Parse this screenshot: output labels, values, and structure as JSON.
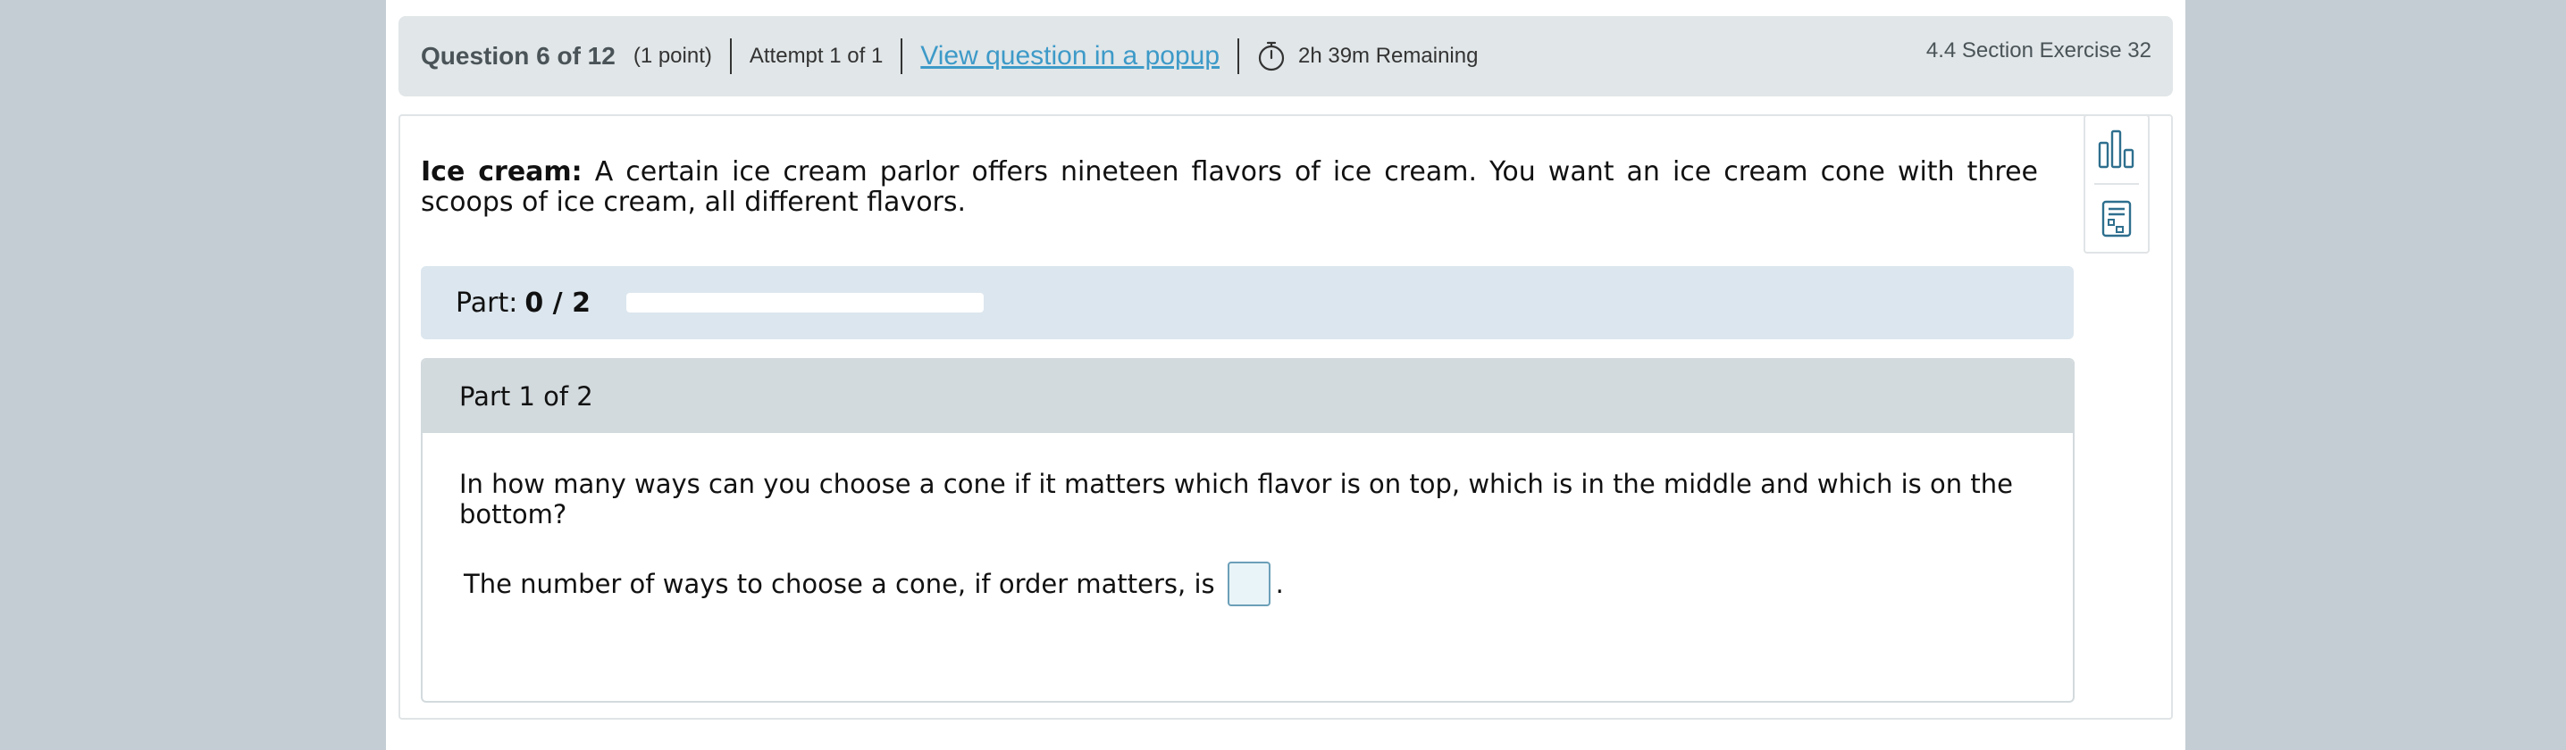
{
  "header": {
    "question_title": "Question 6 of 12",
    "points": "(1 point)",
    "attempt": "Attempt 1 of 1",
    "popup_link": "View question in a popup",
    "remaining": "2h 39m Remaining",
    "section": "4.4 Section Exercise 32"
  },
  "problem": {
    "lead": "Ice cream:",
    "text": "A certain ice cream parlor offers nineteen flavors of ice cream. You want an ice cream cone with three scoops of ice cream, all different flavors."
  },
  "progress": {
    "label": "Part:",
    "value": "0 / 2",
    "fraction": 0
  },
  "part": {
    "title": "Part 1 of 2",
    "question": "In how many ways can you choose a cone if it matters which flavor is on top, which is in the middle and which is on the bottom?",
    "answer_prefix": "The number of ways to choose a cone, if order matters, is",
    "answer_value": "",
    "answer_suffix": "."
  },
  "tools": [
    {
      "icon": "bar-chart-icon"
    },
    {
      "icon": "calculator-icon"
    }
  ],
  "colors": {
    "background": "#c3cdd3",
    "header_bg": "#e1e6e8",
    "link": "#3d9ac8",
    "part_bar_bg": "#dce6ee",
    "part_head_bg": "#d3dadd",
    "input_bg": "#e9f4f8",
    "icon": "#2e6f8e"
  }
}
